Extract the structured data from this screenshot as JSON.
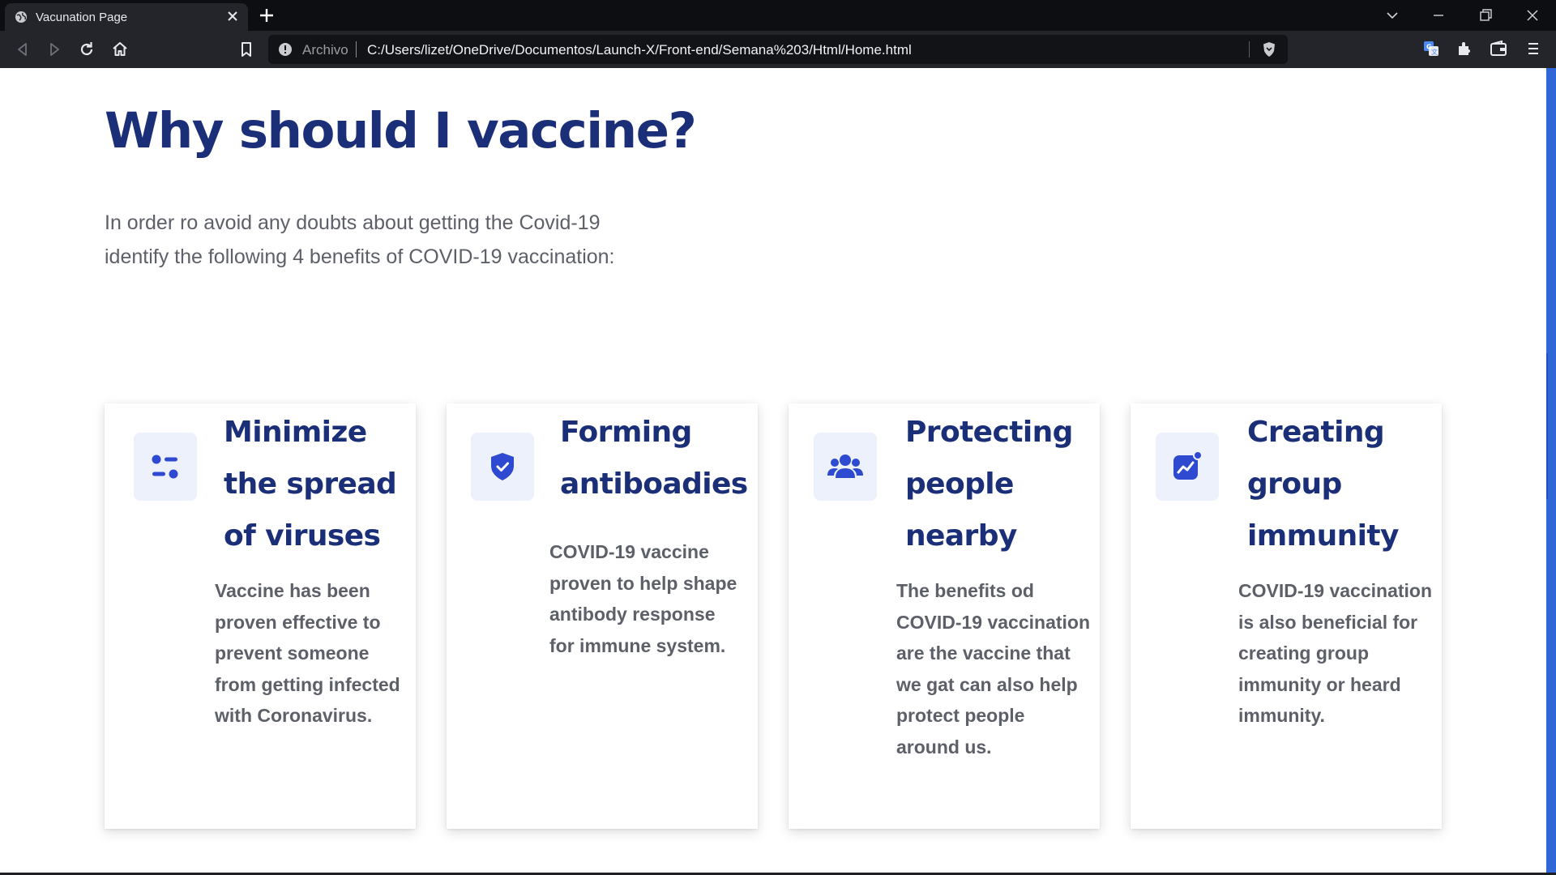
{
  "browser": {
    "tab_title": "Vacunation Page",
    "url_scheme": "Archivo",
    "url": "C:/Users/lizet/OneDrive/Documentos/Launch-X/Front-end/Semana%203/Html/Home.html"
  },
  "page": {
    "heading": "Why should I vaccine?",
    "intro": "In order ro avoid any doubts about getting the Covid-19 identify the following 4 benefits of COVID-19 vaccination:"
  },
  "cards": [
    {
      "icon": "sliders-icon",
      "title": "Minimize the spread of viruses",
      "body": "Vaccine has been proven effective to prevent someone from getting infected with Coronavirus."
    },
    {
      "icon": "shield-check-icon",
      "title": "Forming antiboadies",
      "body": "COVID-19 vaccine proven to help shape antibody response for immune system."
    },
    {
      "icon": "people-icon",
      "title": "Protecting people nearby",
      "body": "The benefits od COVID-19 vaccination are the vaccine that we gat can also help protect people around us."
    },
    {
      "icon": "chart-notification-icon",
      "title": "Creating group immunity",
      "body": "COVID-19 vaccination is also beneficial for creating group immunity or heard immunity."
    }
  ],
  "colors": {
    "accent": "#1b2f78",
    "icon": "#2d4ad1",
    "icon_bg": "#edf1fb",
    "body_text": "#5d6068"
  }
}
